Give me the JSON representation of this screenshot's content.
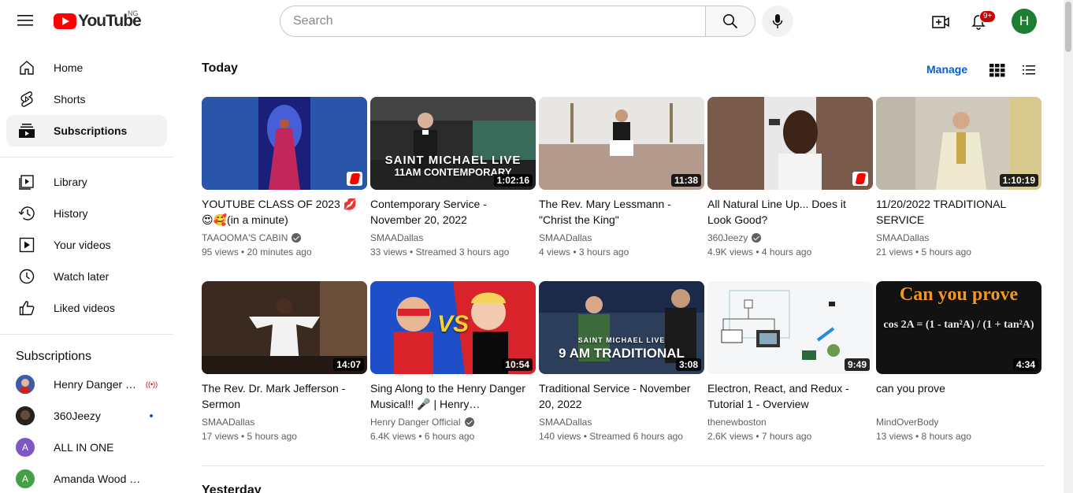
{
  "topbar": {
    "logo_text": "YouTube",
    "country": "NG",
    "search_placeholder": "Search",
    "notif_count": "9+",
    "avatar_letter": "H"
  },
  "sidebar": {
    "nav": [
      {
        "label": "Home",
        "icon": "home-icon"
      },
      {
        "label": "Shorts",
        "icon": "shorts-icon"
      },
      {
        "label": "Subscriptions",
        "icon": "subscriptions-icon",
        "active": true
      }
    ],
    "library": [
      {
        "label": "Library",
        "icon": "library-icon"
      },
      {
        "label": "History",
        "icon": "history-icon"
      },
      {
        "label": "Your videos",
        "icon": "your-videos-icon"
      },
      {
        "label": "Watch later",
        "icon": "watch-later-icon"
      },
      {
        "label": "Liked videos",
        "icon": "liked-videos-icon"
      }
    ],
    "subs_title": "Subscriptions",
    "subs": [
      {
        "label": "Henry Danger O...",
        "indicator": "live"
      },
      {
        "label": "360Jeezy",
        "indicator": "dot"
      },
      {
        "label": "ALL IN ONE",
        "letter": "A",
        "color": "#7e57c2"
      },
      {
        "label": "Amanda Wood Vlogs",
        "letter": "A",
        "color": "#43a047"
      }
    ]
  },
  "main": {
    "section_today": "Today",
    "manage": "Manage",
    "section_yesterday": "Yesterday",
    "videos": [
      {
        "title": "YOUTUBE CLASS OF 2023 💋 😍🥰(in a minute)",
        "channel": "TAAOOMA'S CABIN",
        "verified": true,
        "meta": "95 views • 20 minutes ago",
        "duration": "",
        "shorts": true
      },
      {
        "title": "Contemporary Service - November 20, 2022",
        "channel": "SMAADallas",
        "verified": false,
        "meta": "33 views • Streamed 3 hours ago",
        "duration": "1:02:16",
        "overlay1": "SAINT MICHAEL LIVE",
        "overlay2": "11AM CONTEMPORARY"
      },
      {
        "title": "The Rev. Mary Lessmann - \"Christ the King\"",
        "channel": "SMAADallas",
        "verified": false,
        "meta": "4 views • 3 hours ago",
        "duration": "11:38"
      },
      {
        "title": "All Natural Line Up... Does it Look Good?",
        "channel": "360Jeezy",
        "verified": true,
        "meta": "4.9K views • 4 hours ago",
        "duration": "",
        "shorts": true
      },
      {
        "title": "11/20/2022 TRADITIONAL SERVICE",
        "channel": "SMAADallas",
        "verified": false,
        "meta": "21 views • 5 hours ago",
        "duration": "1:10:19"
      },
      {
        "title": "The Rev. Dr. Mark Jefferson - Sermon",
        "channel": "SMAADallas",
        "verified": false,
        "meta": "17 views • 5 hours ago",
        "duration": "14:07"
      },
      {
        "title": "Sing Along to the Henry Danger Musical!! 🎤 | Henry…",
        "channel": "Henry Danger Official",
        "verified": true,
        "meta": "6.4K views • 6 hours ago",
        "duration": "10:54",
        "overlay1": "VS"
      },
      {
        "title": "Traditional Service - November 20, 2022",
        "channel": "SMAADallas",
        "verified": false,
        "meta": "140 views • Streamed 6 hours ago",
        "duration": "3:08",
        "overlay1": "SAINT MICHAEL LIVE",
        "overlay2": "9 AM TRADITIONAL"
      },
      {
        "title": "Electron, React, and Redux - Tutorial 1 - Overview",
        "channel": "thenewboston",
        "verified": false,
        "meta": "2.6K views • 7 hours ago",
        "duration": "9:49"
      },
      {
        "title": "can you prove",
        "channel": "MindOverBody",
        "verified": false,
        "meta": "13 views • 8 hours ago",
        "duration": "4:34",
        "overlay1": "Can you prove",
        "overlay2": "cos 2A = (1 - tan²A) / (1 + tan²A)"
      }
    ]
  }
}
